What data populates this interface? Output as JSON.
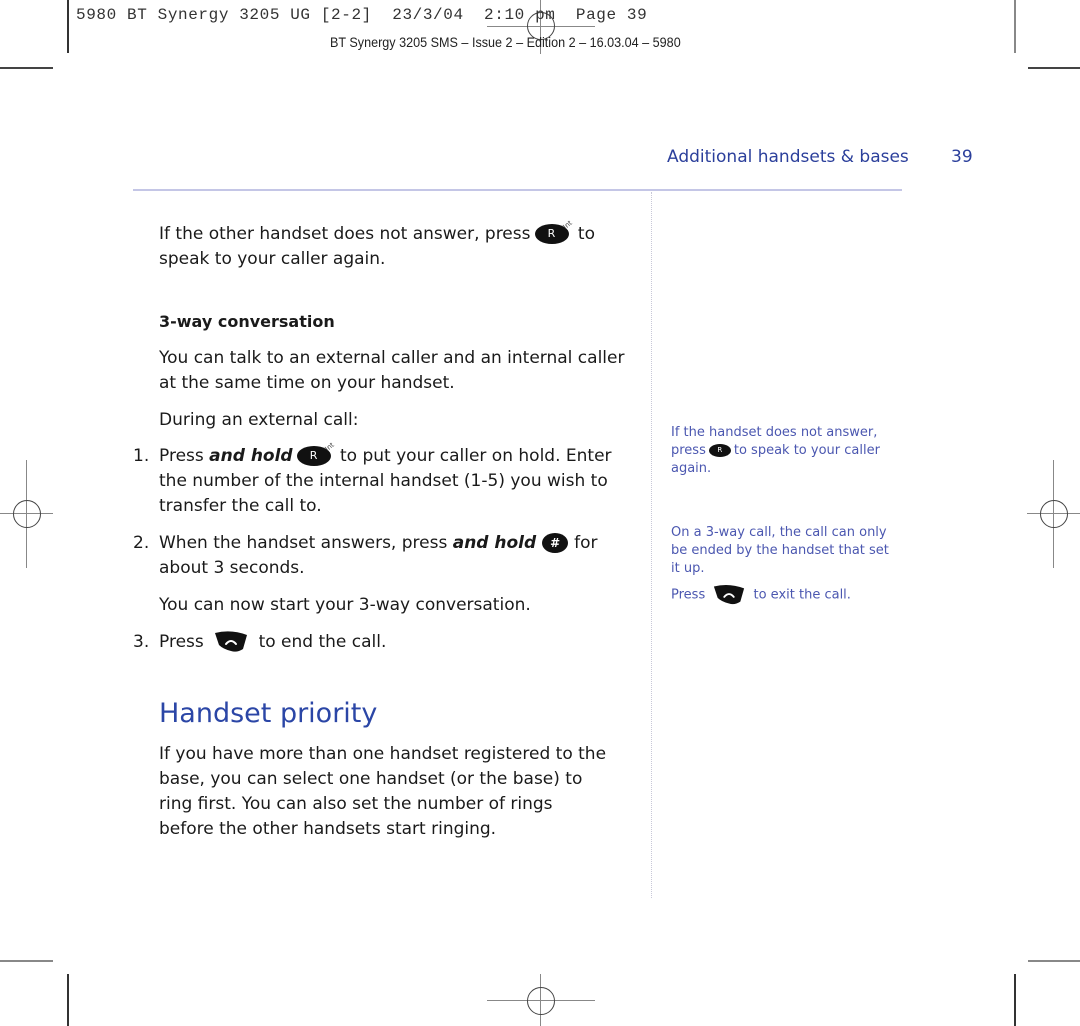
{
  "print_header": {
    "slug": "5980 BT Synergy 3205 UG [2-2]  23/3/04  2:10 pm  Page 39",
    "subslug": "BT Synergy 3205 SMS – Issue 2 – Edition 2 – 16.03.04 – 5980"
  },
  "header": {
    "section_title": "Additional handsets & bases",
    "page_number": "39"
  },
  "main": {
    "intro": {
      "before_key": "If the other handset does not answer, press",
      "key_label": "R",
      "key_sup": "Int",
      "after_key": "to speak to your caller again."
    },
    "subheading": "3-way conversation",
    "para1": "You can talk to an external caller and an internal caller at the same time on your handset.",
    "para2": "During an external call:",
    "steps": [
      {
        "number": "1.",
        "prefix": "Press",
        "emphasis": "and hold",
        "key_label": "R",
        "key_sup": "Int",
        "suffix": "to put your caller on hold. Enter the number of the internal handset (1-5) you wish to transfer the call to."
      },
      {
        "number": "2.",
        "prefix": "When the handset answers, press",
        "emphasis": "and hold",
        "key_label": "#",
        "suffix": "for about 3 seconds."
      },
      {
        "number": "3.",
        "prefix": "Press",
        "key_icon": "end-call-icon",
        "suffix": "to end the call."
      }
    ],
    "after_step2": "You can now start your 3-way conversation.",
    "heading": "Handset priority",
    "para3": "If you have more than one handset registered to the base, you can select one handset (or the base) to ring first. You can also set the number of rings before the other handsets start ringing."
  },
  "sidebar": {
    "note1": {
      "line1": "If the handset does not answer,",
      "before_key": "press",
      "key_label": "R",
      "after_key": "to speak to your caller again."
    },
    "note2": "On a 3-way call, the call can only be ended by the handset that set it up.",
    "note3": {
      "before_key": "Press",
      "after_key": "to exit the call."
    }
  }
}
